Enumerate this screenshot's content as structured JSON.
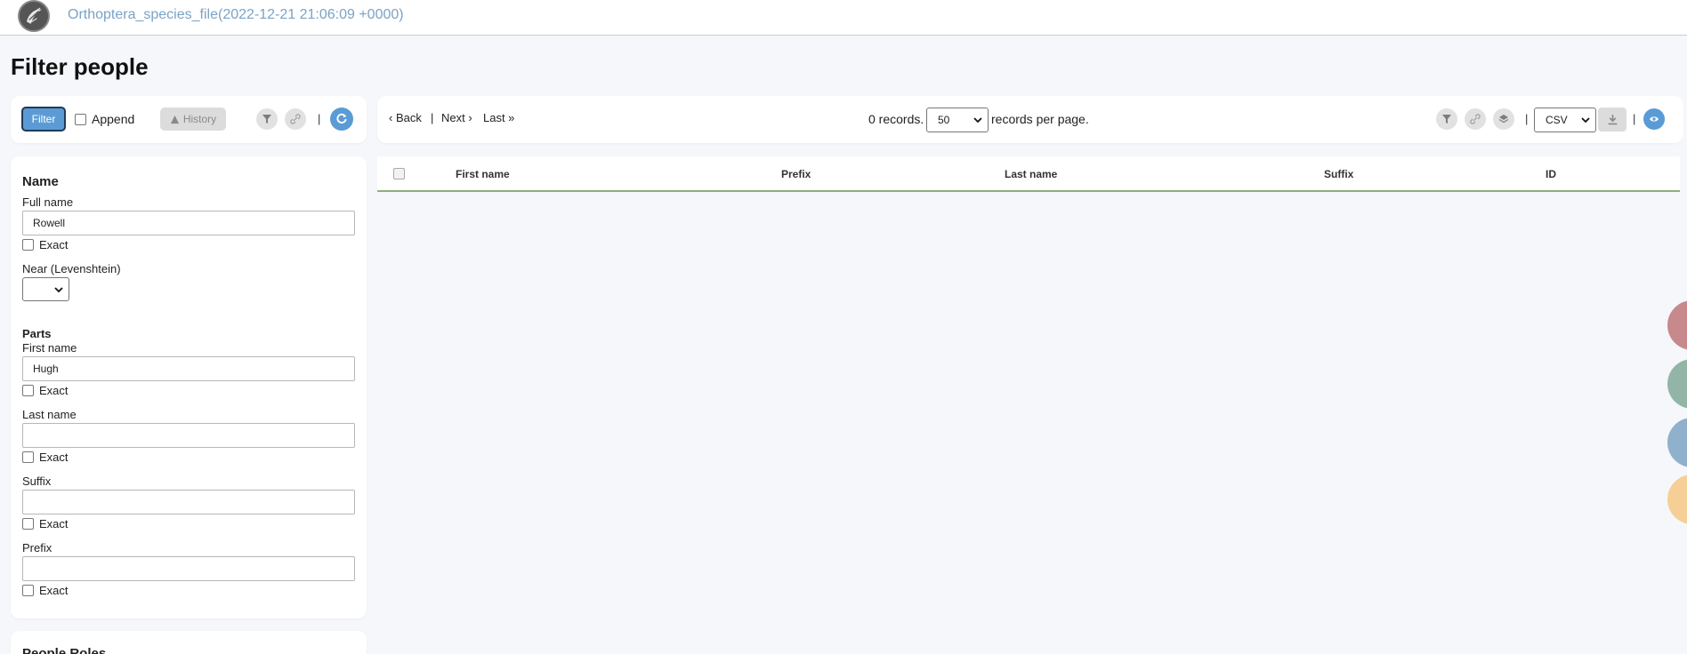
{
  "header": {
    "project_title": "Orthoptera_species_file(2022-12-21 21:06:09 +0000)",
    "logo_icon": "cricket-logo-icon"
  },
  "page": {
    "title": "Filter people"
  },
  "filter_bar": {
    "filter_label": "Filter",
    "append_label": "Append",
    "history_label": "History",
    "separator": "|"
  },
  "results_bar": {
    "back_label": "‹ Back",
    "divider": "|",
    "next_label": "Next ›",
    "last_label": "Last »",
    "records_label": "0 records.",
    "per_page_value": "50",
    "per_page_label": "records per page.",
    "export_value": "CSV",
    "separator": "|"
  },
  "table": {
    "columns": [
      "First name",
      "Prefix",
      "Last name",
      "Suffix",
      "ID"
    ]
  },
  "form": {
    "name_title": "Name",
    "full_name_label": "Full name",
    "full_name_value": "Rowell",
    "exact_label": "Exact",
    "near_label": "Near (Levenshtein)",
    "parts_title": "Parts",
    "first_name_label": "First name",
    "first_name_value": "Hugh",
    "last_name_label": "Last name",
    "last_name_value": "",
    "suffix_label": "Suffix",
    "suffix_value": "",
    "prefix_label": "Prefix",
    "prefix_value": "",
    "next_section_title": "People Roles"
  },
  "colors": {
    "accent": "#5b9bd5",
    "header_link": "#7aa3c6",
    "table_border": "#8fae7a",
    "float_red": "#c8898c",
    "float_green": "#93b5a8",
    "float_blue": "#8fb1cb",
    "float_orange": "#f6cf96"
  }
}
